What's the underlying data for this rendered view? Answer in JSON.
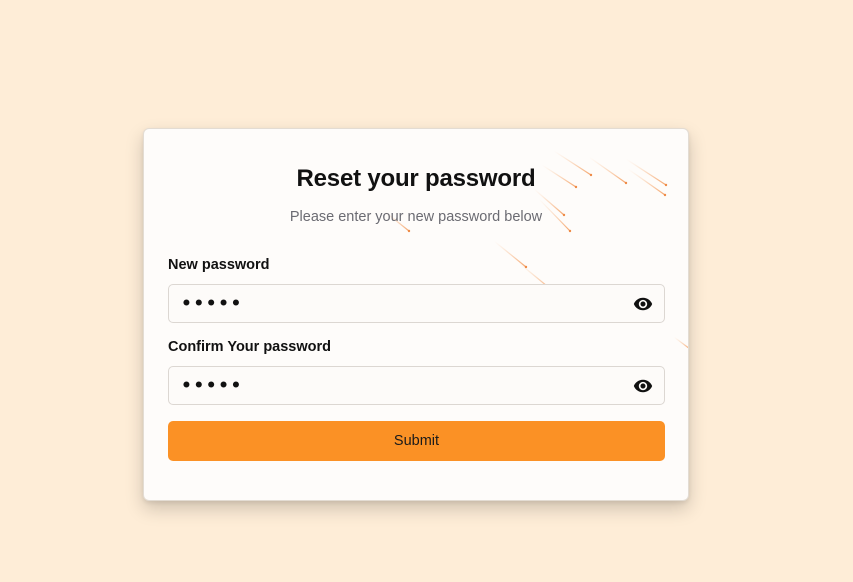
{
  "form": {
    "title": "Reset your password",
    "subtitle": "Please enter your new password below",
    "new_password": {
      "label": "New password",
      "value_masked": "•••••"
    },
    "confirm_password": {
      "label": "Confirm Your password",
      "value_masked": "•••••"
    },
    "submit_label": "Submit"
  },
  "colors": {
    "page_background": "#feedd7",
    "card_background": "#fefcfa",
    "accent": "#fb9125",
    "meteor": "#f7b27a"
  },
  "icons": {
    "toggle_visibility": "eye-icon"
  }
}
